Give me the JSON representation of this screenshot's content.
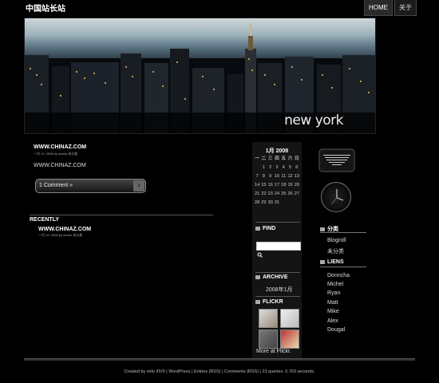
{
  "site": {
    "title": "中国站长站"
  },
  "nav": {
    "items": [
      {
        "label": "HOME"
      },
      {
        "label": "关于"
      }
    ]
  },
  "header": {
    "caption": "new york"
  },
  "post": {
    "title": "WWW.CHINAZ.COM",
    "meta": "一月 10, 2008 by admin 未分类",
    "body": "WWW.CHINAZ.COM",
    "comment_label": "1 Comment »",
    "comment_arrow": "›"
  },
  "recent": {
    "title": "RECENTLY",
    "item_title": "WWW.CHINAZ.COM",
    "item_meta": "一月 10, 2008 by admin 未分类"
  },
  "calendar": {
    "title": "1月 2008",
    "headers": [
      "一",
      "二",
      "三",
      "四",
      "五",
      "六",
      "日"
    ],
    "rows": [
      [
        "",
        "1",
        "2",
        "3",
        "4",
        "5",
        "6"
      ],
      [
        "7",
        "8",
        "9",
        "10",
        "11",
        "12",
        "13"
      ],
      [
        "14",
        "15",
        "16",
        "17",
        "18",
        "19",
        "20"
      ],
      [
        "21",
        "22",
        "23",
        "24",
        "25",
        "26",
        "27"
      ],
      [
        "28",
        "29",
        "30",
        "31",
        "",
        "",
        ""
      ]
    ]
  },
  "find": {
    "title": "FIND",
    "placeholder": "",
    "icon": "search-icon"
  },
  "archive": {
    "title": "ARCHIVE",
    "link": "2008年1月"
  },
  "flickr": {
    "title": "FLICKR",
    "more": "More at Flickr."
  },
  "categories": {
    "title": "分类",
    "items": [
      "Blogroll",
      "未分类"
    ]
  },
  "liens": {
    "title": "LIENS",
    "items": [
      "Donncha",
      "Michel",
      "Ryan",
      "Matt",
      "Mike",
      "Alex",
      "Dougal"
    ]
  },
  "footer": {
    "text": "Created by milo IIIVII | WordPress | Entries (RSS) | Comments (RSS) | 23 queries. 0.763 seconds."
  },
  "colors": {
    "background": "#000000",
    "panel": "#141414",
    "text": "#cccccc"
  }
}
